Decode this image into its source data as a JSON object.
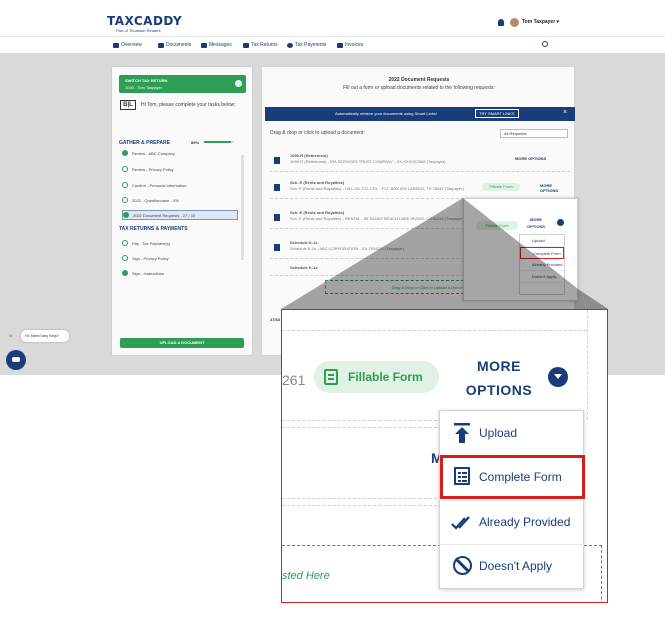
{
  "app": {
    "logo": "TAXCADDY",
    "logo_sub": "Part of Thomson Reuters",
    "user_name": "Tom Taxpayer",
    "nav": [
      {
        "label": "Overview"
      },
      {
        "label": "Documents"
      },
      {
        "label": "Messages"
      },
      {
        "label": "Tax Returns"
      },
      {
        "label": "Tax Payments"
      },
      {
        "label": "Invoices"
      }
    ]
  },
  "tasks": {
    "switch_title": "SWITCH TAX RETURN",
    "switch_sub": "1040 - Tom Taxpayer",
    "brand_mark": "B|L",
    "greeting": "Hi Tom, please complete your tasks below:",
    "gather_heading": "GATHER & PREPARE",
    "gather_pct": "89%",
    "gather_progress": 0.89,
    "items": [
      {
        "label": "Review - ABC Company",
        "done": true
      },
      {
        "label": "Review - Privacy Policy",
        "done": false
      },
      {
        "label": "Confirm - Personal Information",
        "done": false
      },
      {
        "label": "2022 - Questionnaire - 0%",
        "done": false
      },
      {
        "label": "2022 Document Requests - 27 / 33",
        "done": true
      }
    ],
    "returns_heading": "TAX RETURNS & PAYMENTS",
    "return_items": [
      {
        "label": "Pay - Tax Payment(s)",
        "done": false
      },
      {
        "label": "Sign - Privacy Policy",
        "done": false
      },
      {
        "label": "Sign - Instructions",
        "done": true
      }
    ],
    "upload_button": "UPLOAD A DOCUMENT"
  },
  "docs": {
    "title": "2022 Document Requests",
    "subtitle": "Fill out a form or upload documents related to the following requests:",
    "smart_text": "Automatically retrieve your documents using Smart Links!",
    "smart_button": "TRY SMART LINKS",
    "drag_label": "Drag & drop or click to upload a document:",
    "filter_value": "All Requests",
    "rows": [
      {
        "name": "1099-R (Retirement)",
        "desc": "1099-R (Retirement) - IRA SERVICES TRUST COMPANY - XX-XXXXX2565 (Taxpayer)"
      },
      {
        "name": "Sch. E (Rents and Royalties)",
        "desc": "Sch. E (Rents and Royalties) - HILL OIL CO, LTD. - P.O. BOX 699 LAREDO, TX 78042 (Taxpayer)"
      },
      {
        "name": "Sch. E (Rents and Royalties)",
        "desc": "Sch. E (Rents and Royalties) - RENTAL - 55 SANDY BEACH LAKE IRVING, CA 92261 (Taxpayer)"
      },
      {
        "name": "Schedule K-1s",
        "desc": "Schedule K-1s - ABC CORPORATION - XX-7654321 (Taxpayer)"
      },
      {
        "name": "Schedule K-1s",
        "desc": ""
      }
    ],
    "more_options": "MORE OPTIONS",
    "fillable": "Fillable Form",
    "dropzone": "Drag & Drop or Click to Upload a Document Not Listed Here",
    "count": "27/33"
  },
  "chat": {
    "bubble": "Hi. Need any help?",
    "close": "×"
  },
  "zoom": {
    "row_suffix": "261",
    "fillable": "Fillable Form",
    "more_line1": "MORE",
    "more_line2": "OPTIONS",
    "partial_letter": "M",
    "partial_drop": "sted Here",
    "menu": [
      {
        "label": "Upload",
        "icon": "upload-icon"
      },
      {
        "label": "Complete Form",
        "icon": "form-icon"
      },
      {
        "label": "Already Provided",
        "icon": "double-check-icon"
      },
      {
        "label": "Doesn't Apply",
        "icon": "ban-icon"
      }
    ],
    "highlight_color": "#d61e1e",
    "accent": "#1a3d7a",
    "green": "#2e9e55"
  }
}
